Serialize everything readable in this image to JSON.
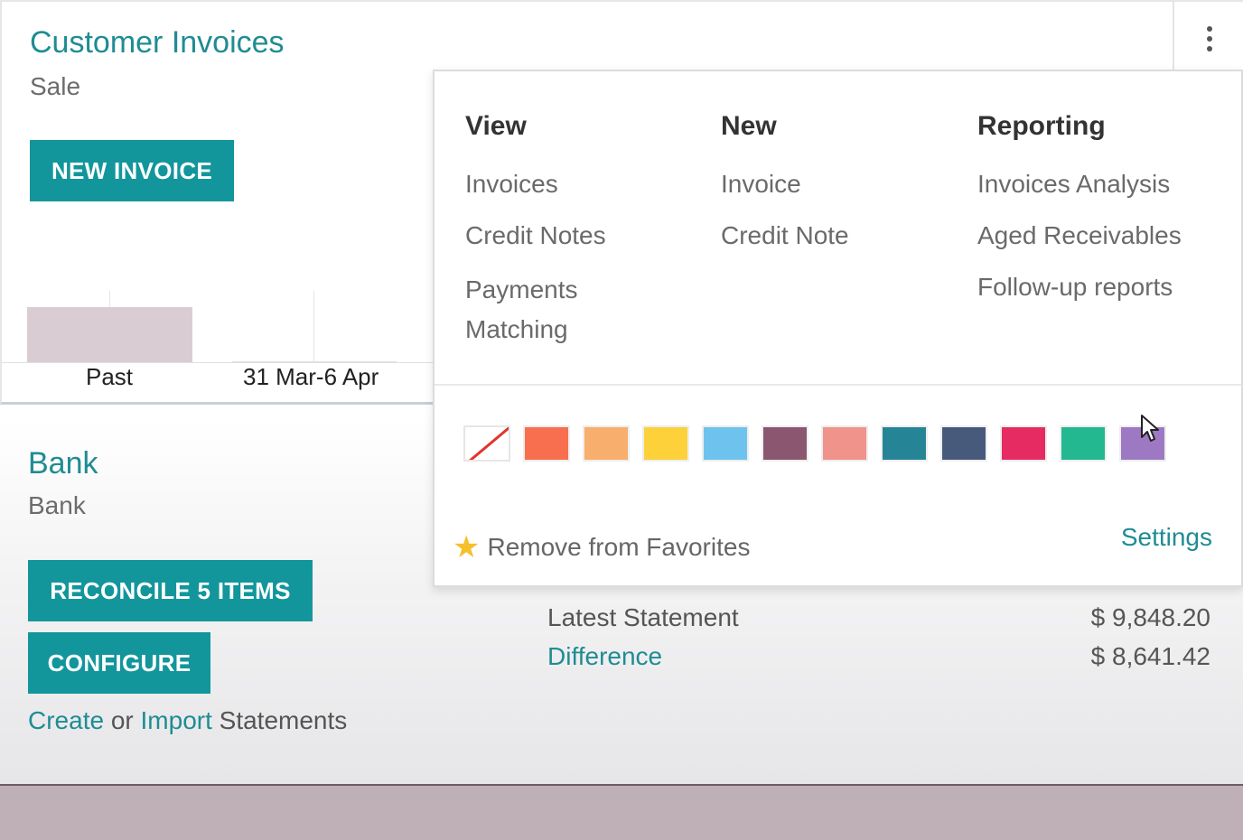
{
  "invoices_card": {
    "title": "Customer Invoices",
    "subtitle": "Sale",
    "new_invoice_button": "NEW INVOICE",
    "chart_labels": [
      "Past",
      "31 Mar-6 Apr"
    ]
  },
  "bank_card": {
    "title": "Bank",
    "subtitle": "Bank",
    "reconcile_button": "RECONCILE 5 ITEMS",
    "configure_button": "CONFIGURE",
    "create_link": "Create",
    "or_text": " or ",
    "import_link": "Import",
    "statements_text": " Statements",
    "stats": [
      {
        "label": "Latest Statement",
        "value": "$ 9,848.20"
      },
      {
        "label": "Difference",
        "value": "$ 8,641.42"
      }
    ]
  },
  "dropdown": {
    "columns": [
      {
        "heading": "View",
        "items": [
          "Invoices",
          "Credit Notes",
          "Payments Matching"
        ]
      },
      {
        "heading": "New",
        "items": [
          "Invoice",
          "Credit Note"
        ]
      },
      {
        "heading": "Reporting",
        "items": [
          "Invoices Analysis",
          "Aged Receivables",
          "Follow-up reports"
        ]
      }
    ],
    "color_swatches": [
      "none",
      "#f76f4e",
      "#f8ae6c",
      "#fcd13a",
      "#6ec3ee",
      "#8b5670",
      "#f0938a",
      "#258597",
      "#485a7b",
      "#e52b62",
      "#23b88f",
      "#9d79c3"
    ],
    "favorite_label": "Remove from Favorites",
    "settings_label": "Settings"
  }
}
